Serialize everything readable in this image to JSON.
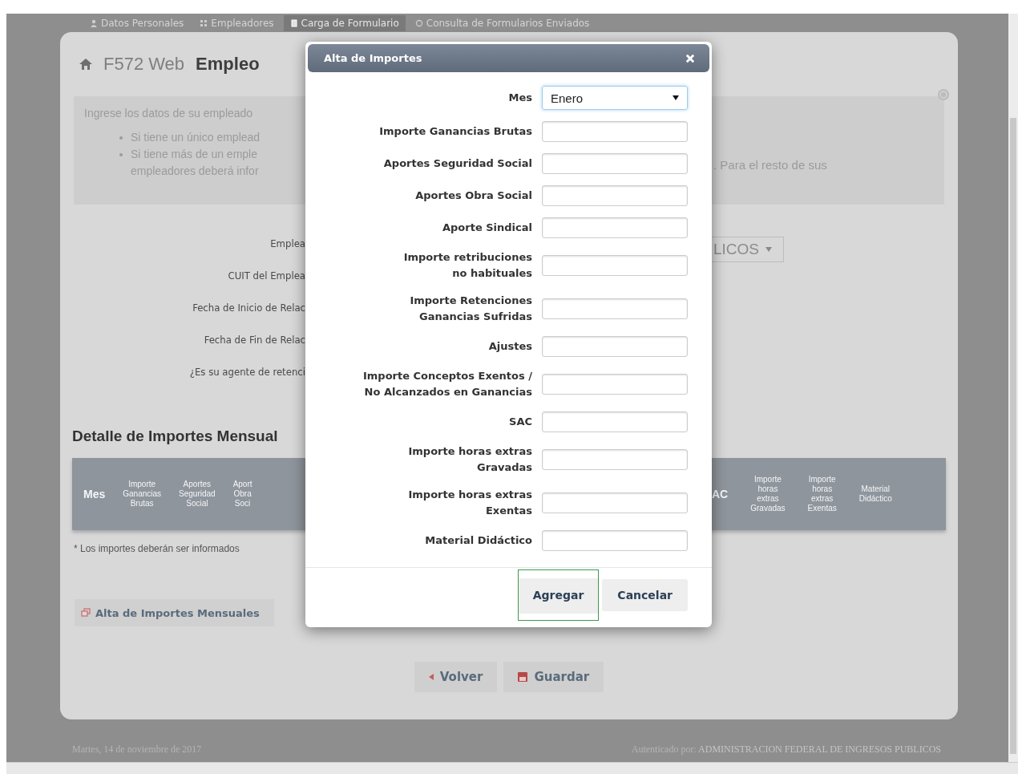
{
  "nav": [
    {
      "label": "Datos Personales",
      "selected": false
    },
    {
      "label": "Empleadores",
      "selected": false
    },
    {
      "label": "Carga de Formulario",
      "selected": true
    },
    {
      "label": "Consulta de Formularios Enviados",
      "selected": false
    }
  ],
  "breadcrumb": {
    "app": "F572 Web",
    "page": "Empleo"
  },
  "info": {
    "intro": "Ingrese los datos de su empleado",
    "bullets": [
      {
        "lines": [
          "Si tiene un único emplead"
        ]
      },
      {
        "lines": [
          "Si tiene más de un emple",
          "empleadores deberá infor"
        ]
      }
    ],
    "right_text": ". Para el resto de sus"
  },
  "form_labels": [
    "Emplea",
    "CUIT del Emplea",
    "Fecha de Inicio de Relac",
    "Fecha de Fin de Relac",
    "¿Es su agente de retenci"
  ],
  "employer_select": {
    "value": "LICOS"
  },
  "detail_heading": "Detalle de Importes Mensual",
  "table": {
    "left_columns": [
      "Mes",
      "Importe\nGanancias\nBrutas",
      "Aportes\nSeguridad\nSocial",
      "Aport\nObra\nSoci"
    ],
    "right_columns": [
      "AC",
      "Importe\nhoras\nextras\nGravadas",
      "Importe\nhoras\nextras\nExentas",
      "Material\nDidáctico"
    ]
  },
  "note": "* Los importes deberán ser informados",
  "add_monthly_button": "Alta de Importes Mensuales",
  "actions": [
    {
      "label": "Volver"
    },
    {
      "label": "Guardar"
    }
  ],
  "footer": {
    "date": "Martes, 14 de noviembre de 2017",
    "auth_label": "Autenticado por:",
    "auth_value": "ADMINISTRACION FEDERAL DE INGRESOS PUBLICOS"
  },
  "dialog": {
    "title": "Alta de Importes",
    "fields": [
      {
        "label": "Mes",
        "kind": "select",
        "value": "Enero"
      },
      {
        "label": "Importe Ganancias Brutas",
        "kind": "text"
      },
      {
        "label": "Aportes Seguridad Social",
        "kind": "text"
      },
      {
        "label": "Aportes Obra Social",
        "kind": "text"
      },
      {
        "label": "Aporte Sindical",
        "kind": "text"
      },
      {
        "label": "Importe retribuciones\nno habituales",
        "kind": "text"
      },
      {
        "label": "Importe Retenciones\nGanancias Sufridas",
        "kind": "text"
      },
      {
        "label": "Ajustes",
        "kind": "text"
      },
      {
        "label": "Importe Conceptos Exentos /\nNo Alcanzados en Ganancias",
        "kind": "text"
      },
      {
        "label": "SAC",
        "kind": "text"
      },
      {
        "label": "Importe horas extras\nGravadas",
        "kind": "text"
      },
      {
        "label": "Importe horas extras\nExentas",
        "kind": "text"
      },
      {
        "label": "Material Didáctico",
        "kind": "text"
      }
    ],
    "buttons": [
      {
        "label": "Agregar",
        "focused": true
      },
      {
        "label": "Cancelar",
        "focused": false
      }
    ]
  }
}
